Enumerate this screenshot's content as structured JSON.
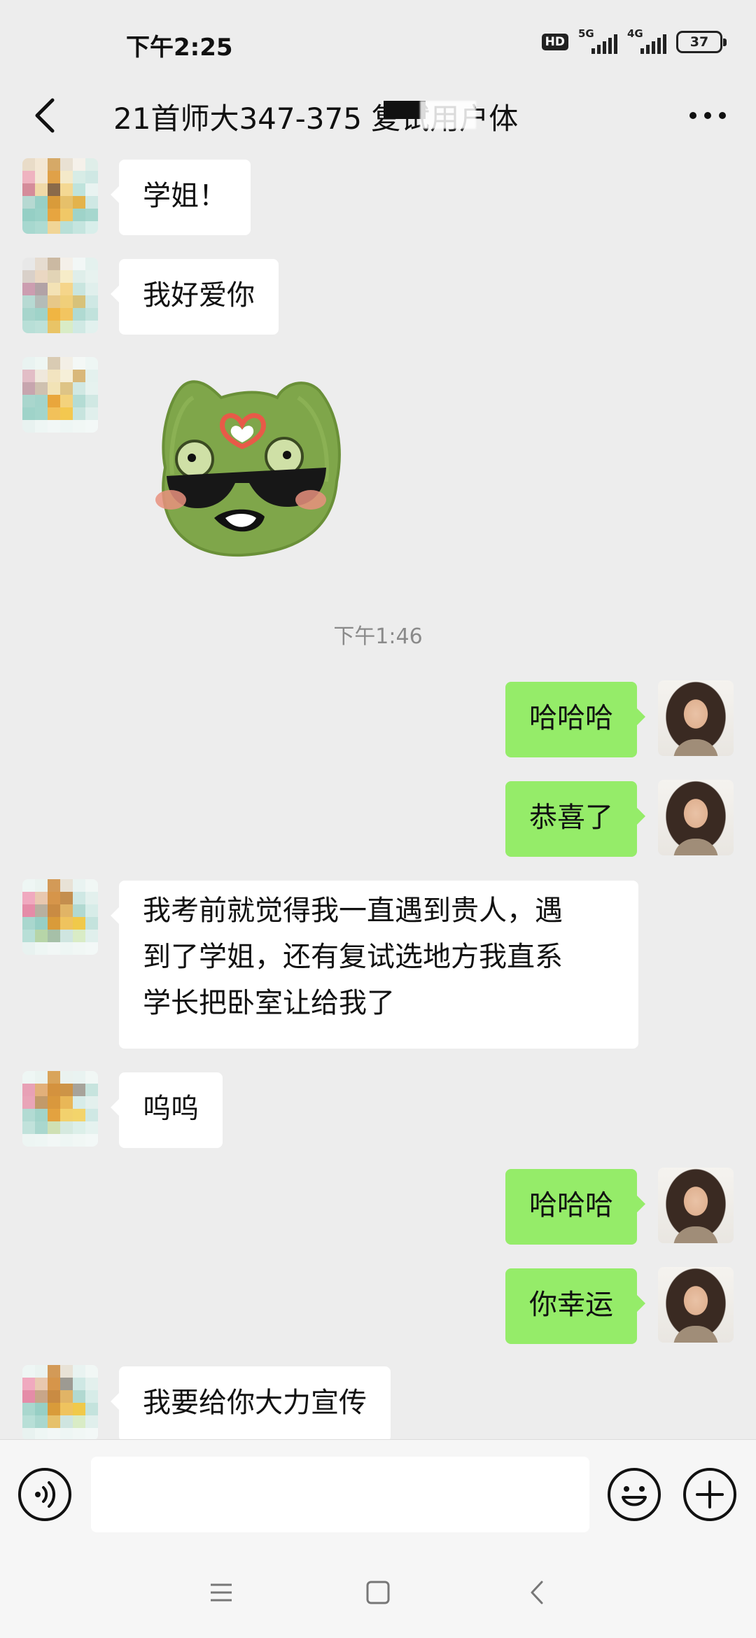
{
  "status_bar": {
    "time": "下午2:25",
    "hd_label": "HD",
    "network_1": "5G",
    "network_2": "4G",
    "battery": "37"
  },
  "header": {
    "title": "21首师大347-375 复试用户体",
    "back_icon": "chevron-left-icon",
    "more_icon": "more-dots-icon"
  },
  "messages": [
    {
      "side": "in",
      "type": "text",
      "text": "学姐！"
    },
    {
      "side": "in",
      "type": "text",
      "text": "我好爱你"
    },
    {
      "side": "in",
      "type": "sticker",
      "sticker": "green-frog-sunglasses-heart"
    },
    {
      "type": "timestamp",
      "text": "下午1:46"
    },
    {
      "side": "out",
      "type": "text",
      "text": "哈哈哈"
    },
    {
      "side": "out",
      "type": "text",
      "text": "恭喜了"
    },
    {
      "side": "in",
      "type": "text",
      "lines": [
        "我考前就觉得我一直遇到贵人，遇",
        "到了学姐，还有复试选地方我直系",
        "学长把卧室让给我了"
      ]
    },
    {
      "side": "in",
      "type": "text",
      "text": "呜呜"
    },
    {
      "side": "out",
      "type": "text",
      "text": "哈哈哈"
    },
    {
      "side": "out",
      "type": "text",
      "text": "你幸运"
    },
    {
      "side": "in",
      "type": "text",
      "text": "我要给你大力宣传"
    }
  ],
  "input_bar": {
    "voice_icon": "voice-icon",
    "input_value": "",
    "emoji_icon": "emoji-icon",
    "plus_icon": "plus-icon"
  },
  "system_nav": {
    "menu_icon": "menu-icon",
    "home_icon": "home-icon",
    "back_icon": "back-icon"
  },
  "colors": {
    "background": "#ededed",
    "bubble_out": "#95ec69",
    "bubble_in": "#ffffff"
  }
}
